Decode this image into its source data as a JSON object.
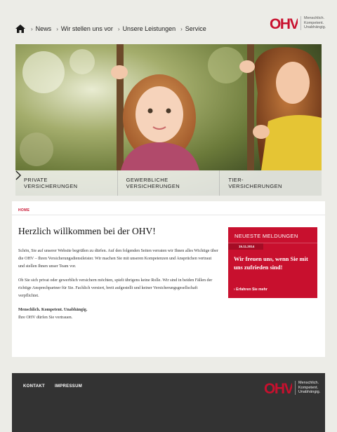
{
  "colors": {
    "brand_red": "#c8102e",
    "background": "#ecece7",
    "footer_bg": "#333333"
  },
  "header": {
    "home_icon": "home-icon",
    "nav": [
      {
        "label": "News"
      },
      {
        "label": "Wir stellen uns vor"
      },
      {
        "label": "Unsere Leistungen"
      },
      {
        "label": "Service"
      }
    ],
    "logo": {
      "text": "OHV",
      "tag1": "Menschlich.",
      "tag2": "Kompetent.",
      "tag3": "Unabhängig."
    }
  },
  "hero": {
    "categories": [
      {
        "line1": "Private",
        "line2": "Versicherungen"
      },
      {
        "line1": "Gewerbliche",
        "line2": "Versicherungen"
      },
      {
        "line1": "Tier-",
        "line2": "Versicherungen"
      }
    ]
  },
  "main": {
    "breadcrumb": "HOME",
    "title": "Herzlich willkommen bei der OHV!",
    "paragraphs": [
      "Schön, Sie auf unserer Website begrüßen zu dürfen. Auf den folgenden Seiten verraten wir Ihnen alles Wichtige über die OHV – Ihren Versicherungsdienstleister. Wir machen Sie mit unseren Kompetenzen und Ansprüchen vertraut und stellen Ihnen unser Team vor.",
      "Ob Sie sich privat oder gewerblich versichern möchten, spielt übrigens keine Rolle. Wir sind in beiden Fällen der richtige Ansprechpartner für Sie. Fachlich versiert, breit aufgestellt und keiner Versicherungsgesellschaft verpflichtet."
    ],
    "motto": "Menschlich. Kompetent. Unabhängig.",
    "motto_sub": "Ihre OHV dürfen Sie vertrauen."
  },
  "news": {
    "heading": "Neueste Meldungen",
    "date": "15.11.2014",
    "text": "Wir freuen uns, wenn Sie mit uns zufrieden sind!",
    "link": "› Erfahren Sie mehr"
  },
  "footer": {
    "links": [
      {
        "label": "KONTAKT"
      },
      {
        "label": "IMPRESSUM"
      }
    ],
    "logo": {
      "text": "OHV",
      "tag1": "Menschlich.",
      "tag2": "Kompetent.",
      "tag3": "Unabhängig."
    }
  }
}
